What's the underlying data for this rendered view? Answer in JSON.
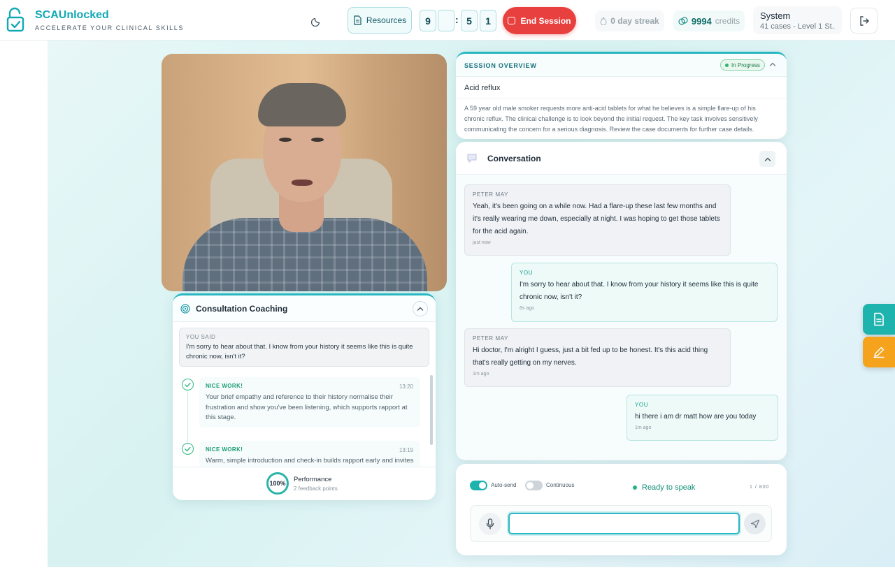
{
  "brand": {
    "title": "SCAUnlocked",
    "subtitle": "ACCELERATE YOUR CLINICAL SKILLS"
  },
  "header": {
    "resources_label": "Resources",
    "timer": [
      "9",
      "",
      "5",
      "1"
    ],
    "timer_sep": ":",
    "end_session_label": "End Session",
    "streak": "0 day streak",
    "credits_value": "9994",
    "credits_label": "credits",
    "system_name": "System",
    "system_sub": "41 cases - Level 1 St..."
  },
  "coaching": {
    "title": "Consultation Coaching",
    "you_said_label": "YOU SAID",
    "you_said_text": "I'm sorry to hear about that. I know from your history it seems like this is quite chronic now, isn't it?",
    "feedback": [
      {
        "label": "NICE WORK!",
        "time": "13:20",
        "text": "Your brief empathy and reference to their history normalise their frustration and show you've been listening, which supports rapport at this stage."
      },
      {
        "label": "NICE WORK!",
        "time": "13:19",
        "text": "Warm, simple introduction and check-in builds rapport early and invites"
      }
    ],
    "performance_value": "100%",
    "performance_label": "Performance",
    "performance_sub": "2 feedback points"
  },
  "overview": {
    "title": "SESSION OVERVIEW",
    "status": "In Progress",
    "case_title": "Acid reflux",
    "description": "A 59 year old male smoker requests more anti-acid tablets for what he believes is a simple flare-up of his chronic reflux. The clinical challenge is to look beyond the initial request. The key task involves sensitively communicating the concern for a serious diagnosis. Review the case documents for further case details."
  },
  "conversation": {
    "title": "Conversation",
    "messages": [
      {
        "who": "PETER MAY",
        "text": "Yeah, it's been going on a while now. Had a flare-up these last few months and it's really wearing me down, especially at night. I was hoping to get those tablets for the acid again.",
        "time": "just now"
      },
      {
        "who": "YOU",
        "text": "I'm sorry to hear about that. I know from your history it seems like this is quite chronic now, isn't it?",
        "time": "6s ago"
      },
      {
        "who": "PETER MAY",
        "text": "Hi doctor, I'm alright I guess, just a bit fed up to be honest. It's this acid thing that's really getting on my nerves.",
        "time": "1m ago"
      },
      {
        "who": "YOU",
        "text": "hi there i am dr matt how are you today",
        "time": "1m ago"
      }
    ]
  },
  "input": {
    "auto_send_label": "Auto-send",
    "auto_send_on": true,
    "continuous_label": "Continuous",
    "continuous_on": false,
    "status": "Ready to speak",
    "counter": "1 / 800",
    "value": "",
    "placeholder": ""
  },
  "colors": {
    "accent": "#1fb3ad",
    "danger": "#e8403f",
    "warning": "#f5a21c",
    "success": "#22b47c"
  }
}
